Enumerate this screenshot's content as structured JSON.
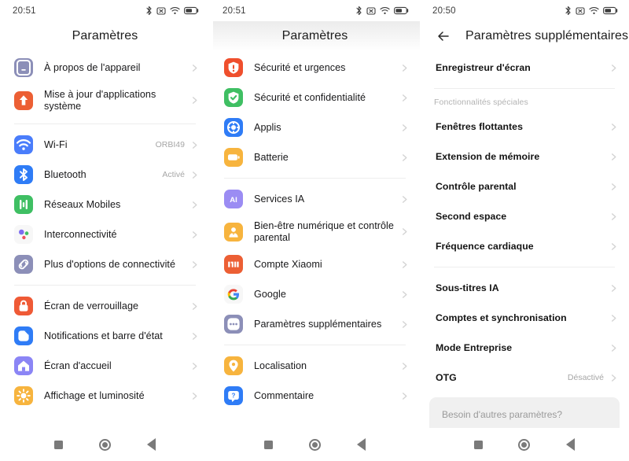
{
  "panels": [
    {
      "id": "settings-main-top",
      "status": {
        "time": "20:51",
        "icons": [
          "bluetooth-icon",
          "mute-icon",
          "wifi-icon",
          "battery-icon"
        ]
      },
      "header": {
        "title": "Paramètres",
        "has_back": false,
        "shaded": false
      },
      "items": [
        {
          "type": "row",
          "label": "À propos de l'appareil",
          "value": "",
          "icon": "device-info-icon",
          "icon_bg": "#8c8fb8"
        },
        {
          "type": "row",
          "label": "Mise à jour d'applications système",
          "value": "",
          "icon": "system-update-icon",
          "icon_bg": "#ec5f34",
          "tall": true
        },
        {
          "type": "divider"
        },
        {
          "type": "row",
          "label": "Wi-Fi",
          "value": "ORBI49",
          "icon": "wifi-settings-icon",
          "icon_bg": "#4a7dfb"
        },
        {
          "type": "row",
          "label": "Bluetooth",
          "value": "Activé",
          "icon": "bluetooth-settings-icon",
          "icon_bg": "#2f7cf6"
        },
        {
          "type": "row",
          "label": "Réseaux Mobiles",
          "value": "",
          "icon": "mobile-network-icon",
          "icon_bg": "#3fbf63"
        },
        {
          "type": "row",
          "label": "Interconnectivité",
          "value": "",
          "icon": "interconnect-icon",
          "icon_bg": "#f7f7f7"
        },
        {
          "type": "row",
          "label": "Plus d'options de connectivité",
          "value": "",
          "icon": "more-connectivity-icon",
          "icon_bg": "#8c8fb8"
        },
        {
          "type": "divider"
        },
        {
          "type": "row",
          "label": "Écran de verrouillage",
          "value": "",
          "icon": "lock-screen-icon",
          "icon_bg": "#ef5a36"
        },
        {
          "type": "row",
          "label": "Notifications et barre d'état",
          "value": "",
          "icon": "notifications-icon",
          "icon_bg": "#2f7cf6"
        },
        {
          "type": "row",
          "label": "Écran d'accueil",
          "value": "",
          "icon": "home-screen-icon",
          "icon_bg": "#8b85f5"
        },
        {
          "type": "row",
          "label": "Affichage et luminosité",
          "value": "",
          "icon": "brightness-icon",
          "icon_bg": "#f7b43e"
        }
      ]
    },
    {
      "id": "settings-main-bottom",
      "status": {
        "time": "20:51",
        "icons": [
          "bluetooth-icon",
          "mute-icon",
          "wifi-icon",
          "battery-icon"
        ]
      },
      "header": {
        "title": "Paramètres",
        "has_back": false,
        "shaded": true
      },
      "items": [
        {
          "type": "row",
          "label": "Sécurité et urgences",
          "value": "",
          "icon": "safety-emergency-icon",
          "icon_bg": "#ef4f2d"
        },
        {
          "type": "row",
          "label": "Sécurité et confidentialité",
          "value": "",
          "icon": "security-privacy-icon",
          "icon_bg": "#3fbf63"
        },
        {
          "type": "row",
          "label": "Applis",
          "value": "",
          "icon": "apps-icon",
          "icon_bg": "#2f7cf6"
        },
        {
          "type": "row",
          "label": "Batterie",
          "value": "",
          "icon": "battery-settings-icon",
          "icon_bg": "#f7b43e"
        },
        {
          "type": "divider"
        },
        {
          "type": "row",
          "label": "Services IA",
          "value": "",
          "icon": "ai-services-icon",
          "icon_bg": "#9b8cf3"
        },
        {
          "type": "row",
          "label": "Bien-être numérique et contrôle parental",
          "value": "",
          "icon": "digital-wellbeing-icon",
          "icon_bg": "#f7b43e",
          "tall": true
        },
        {
          "type": "row",
          "label": "Compte Xiaomi",
          "value": "",
          "icon": "xiaomi-account-icon",
          "icon_bg": "#ec5f34"
        },
        {
          "type": "row",
          "label": "Google",
          "value": "",
          "icon": "google-icon",
          "icon_bg": "#f7f7f7"
        },
        {
          "type": "row",
          "label": "Paramètres supplémentaires",
          "value": "",
          "icon": "additional-settings-icon",
          "icon_bg": "#8c8fb8"
        },
        {
          "type": "divider"
        },
        {
          "type": "row",
          "label": "Localisation",
          "value": "",
          "icon": "location-icon",
          "icon_bg": "#f7b43e"
        },
        {
          "type": "row",
          "label": "Commentaire",
          "value": "",
          "icon": "feedback-icon",
          "icon_bg": "#2f7cf6"
        }
      ]
    },
    {
      "id": "additional-settings",
      "status": {
        "time": "20:50",
        "icons": [
          "bluetooth-icon",
          "mute-icon",
          "wifi-icon",
          "battery-icon"
        ]
      },
      "header": {
        "title": "Paramètres supplémentaires",
        "has_back": true,
        "shaded": false
      },
      "items": [
        {
          "type": "plain",
          "label": "Enregistreur d'écran",
          "value": ""
        },
        {
          "type": "divider"
        },
        {
          "type": "section",
          "label": "Fonctionnalités spéciales"
        },
        {
          "type": "plain",
          "label": "Fenêtres flottantes",
          "value": ""
        },
        {
          "type": "plain",
          "label": "Extension de mémoire",
          "value": ""
        },
        {
          "type": "plain",
          "label": "Contrôle parental",
          "value": ""
        },
        {
          "type": "plain",
          "label": "Second espace",
          "value": ""
        },
        {
          "type": "plain",
          "label": "Fréquence cardiaque",
          "value": ""
        },
        {
          "type": "divider"
        },
        {
          "type": "plain",
          "label": "Sous-titres IA",
          "value": ""
        },
        {
          "type": "plain",
          "label": "Comptes et synchronisation",
          "value": ""
        },
        {
          "type": "plain",
          "label": "Mode Entreprise",
          "value": ""
        },
        {
          "type": "plain",
          "label": "OTG",
          "value": "Désactivé"
        },
        {
          "type": "hint",
          "label": "Besoin d'autres paramètres?"
        }
      ]
    }
  ],
  "navbar": {
    "recents": "recents-button",
    "home": "home-button",
    "back": "back-button"
  }
}
